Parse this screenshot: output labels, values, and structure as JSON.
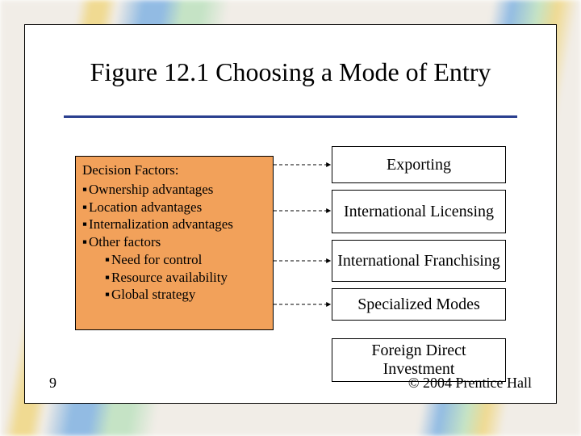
{
  "title": "Figure 12.1 Choosing a Mode of Entry",
  "factors": {
    "heading": "Decision Factors:",
    "items": [
      "Ownership advantages",
      "Location advantages",
      "Internalization advantages",
      "Other factors"
    ],
    "sub_items": [
      "Need for control",
      "Resource availability",
      "Global strategy"
    ]
  },
  "modes": [
    "Exporting",
    "International Licensing",
    "International Franchising",
    "Specialized Modes",
    "Foreign Direct Investment"
  ],
  "page_number": "9",
  "copyright": "© 2004 Prentice Hall"
}
